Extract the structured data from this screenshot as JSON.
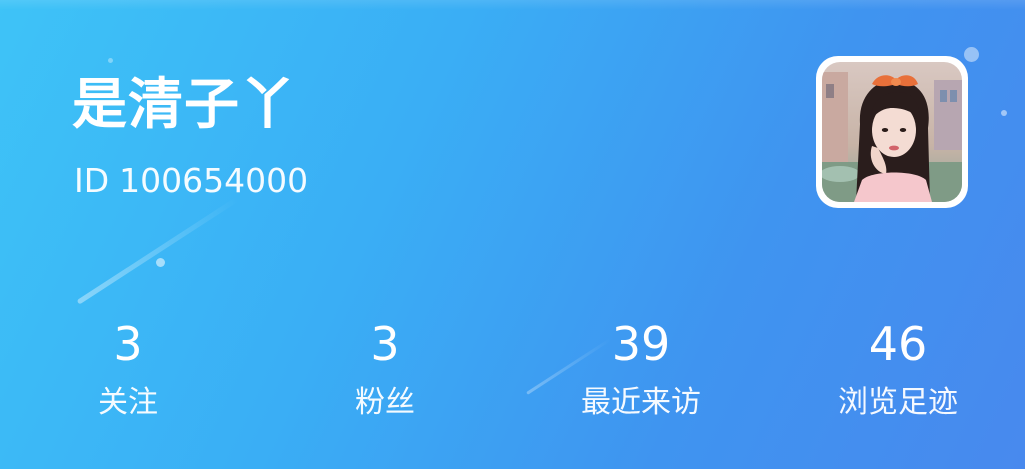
{
  "profile": {
    "username": "是清子丫",
    "id_prefix": "ID",
    "id_number": "100654000"
  },
  "stats": [
    {
      "count": "3",
      "label": "关注"
    },
    {
      "count": "3",
      "label": "粉丝"
    },
    {
      "count": "39",
      "label": "最近来访"
    },
    {
      "count": "46",
      "label": "浏览足迹"
    }
  ],
  "colors": {
    "gradient_start": "#3ec3f7",
    "gradient_end": "#4889ee",
    "text": "#ffffff",
    "avatar_border": "#ffffff"
  }
}
